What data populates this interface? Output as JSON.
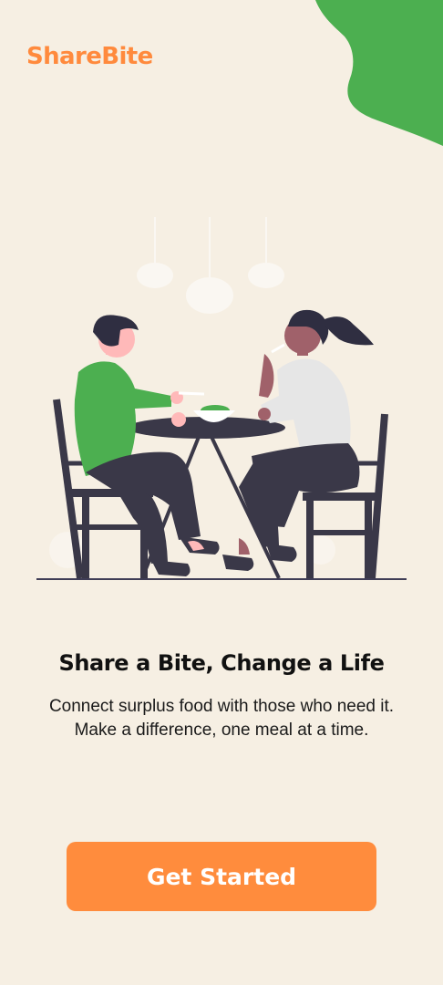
{
  "app": {
    "logo_text": "ShareBite"
  },
  "onboarding": {
    "headline": "Share a Bite, Change a Life",
    "description": "Connect surplus food with those who need it. Make a difference, one meal at a time.",
    "cta_label": "Get Started"
  },
  "theme": {
    "background": "#F6EFE3",
    "brand_orange": "#FF8C3D",
    "accent_green": "#4CAF50",
    "dark_navy": "#2F2E41"
  },
  "icons": {
    "decoration": "green-blob-shape",
    "illustration": "two-people-dining-illustration"
  }
}
